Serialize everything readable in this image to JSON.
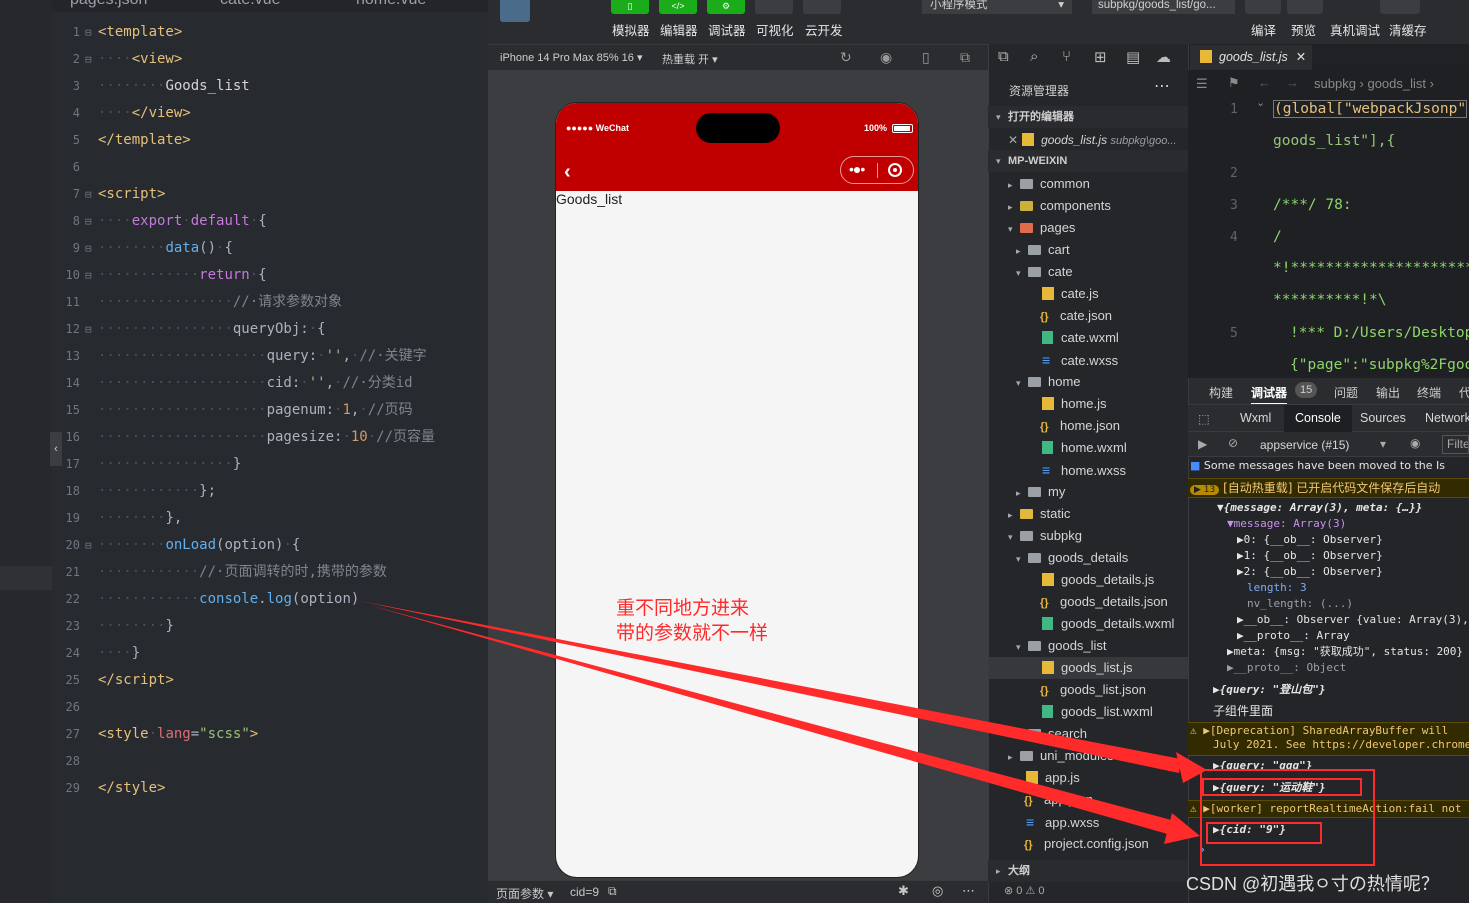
{
  "editor": {
    "tabs": [
      "pages.json",
      "cate.vue",
      "home.vue"
    ]
  },
  "toolbar": {
    "buttons": [
      "模拟器",
      "编辑器",
      "调试器",
      "可视化",
      "云开发"
    ],
    "mode": "小程序模式",
    "page_path": "subpkg/goods_list/go...",
    "right_buttons": [
      "编译",
      "预览",
      "真机调试",
      "清缓存"
    ]
  },
  "simulator": {
    "device": "iPhone 14 Pro Max 85% 16 ▾",
    "hot_reload": "热重载 开 ▾",
    "status_left": "●●●●● WeChat",
    "battery": "100%",
    "page_text": "Goods_list",
    "footer_params": "页面参数 ▾",
    "footer_cid": "cid=9"
  },
  "annotation": {
    "line1": "重不同地方进来",
    "line2": "带的参数就不一样"
  },
  "explorer": {
    "title": "资源管理器",
    "open_editors": "打开的编辑器",
    "open_file": "goods_list.js",
    "open_file_path": "subpkg\\goo...",
    "project": "MP-WEIXIN",
    "outline": "大纲",
    "problems": "⊗ 0 ⚠ 0",
    "tree": {
      "common": "common",
      "components": "components",
      "pages": "pages",
      "cart": "cart",
      "cate": "cate",
      "cate_js": "cate.js",
      "cate_json": "cate.json",
      "cate_wxml": "cate.wxml",
      "cate_wxss": "cate.wxss",
      "home": "home",
      "home_js": "home.js",
      "home_json": "home.json",
      "home_wxml": "home.wxml",
      "home_wxss": "home.wxss",
      "my": "my",
      "static": "static",
      "subpkg": "subpkg",
      "goods_details": "goods_details",
      "goods_details_js": "goods_details.js",
      "goods_details_json": "goods_details.json",
      "goods_details_wxml": "goods_details.wxml",
      "goods_list": "goods_list",
      "goods_list_js": "goods_list.js",
      "goods_list_json": "goods_list.json",
      "goods_list_wxml": "goods_list.wxml",
      "search": "search",
      "uni_modules": "uni_modules",
      "app_js": "app.js",
      "app_json": "app.json",
      "app_wxss": "app.wxss",
      "project_config": "project.config.json"
    }
  },
  "right_pane": {
    "tab": "goods_list.js",
    "breadcrumb": "subpkg › goods_list ›",
    "line1a": "(global[\"webpackJsonp\"",
    "line1b": "goods_list\"],{",
    "line3": "/***/ 78:",
    "line4a": "/",
    "line4b": "*!**********************",
    "line4c": "**********!*\\",
    "line5a": "!*** D:/Users/Desktop",
    "line5b": "{\"page\":\"subpkg%2Fgoo"
  },
  "debugger": {
    "tabs": [
      "构建",
      "调试器",
      "问题",
      "输出",
      "终端",
      "代"
    ],
    "badge": "15",
    "subtabs": [
      "Wxml",
      "Console",
      "Sources",
      "Network"
    ],
    "context": "appservice (#15)",
    "filter": "Filte",
    "console": {
      "msg_moved": "Some messages have been moved to the Is",
      "hot_reload": "[自动热重载] 已开启代码文件保存后自动",
      "hot_reload_badge": "▶ 13",
      "obj_head": "▼{message: Array(3), meta: {…}}",
      "message_arr": "▼message: Array(3)",
      "item0": "▶0: {__ob__: Observer}",
      "item1": "▶1: {__ob__: Observer}",
      "item2": "▶2: {__ob__: Observer}",
      "length": "length: 3",
      "nv_length": "nv_length: (...)",
      "ob": "▶__ob__: Observer {value: Array(3),",
      "proto_arr": "▶__proto__: Array",
      "meta": "▶meta: {msg: \"获取成功\", status: 200}",
      "proto_obj": "▶__proto__: Object",
      "query1": "▶{query: \"登山包\"}",
      "child_text": "子组件里面",
      "deprecation1": "▶[Deprecation] SharedArrayBuffer will",
      "deprecation2": "July 2021. See https://developer.chrome",
      "query2": "▶{query: \"ggg\"}",
      "query3": "▶{query: \"运动鞋\"}",
      "worker": "▶[worker] reportRealtimeAction:fail not",
      "cid": "▶{cid: \"9\"}",
      "prompt": "›"
    }
  },
  "watermark": "CSDN @初遇我ㅇ寸の热情呢？",
  "colors": {
    "nav_red": "#c00000",
    "annot_red": "#ff2a2a",
    "wechat_green": "#1aad19"
  }
}
